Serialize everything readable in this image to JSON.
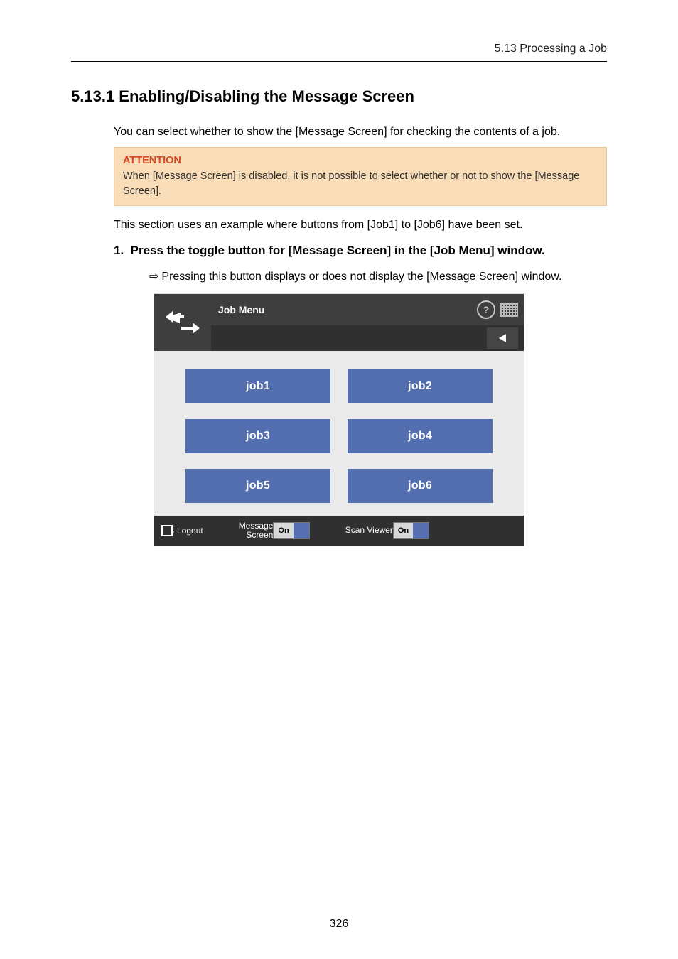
{
  "running_header": "5.13 Processing a Job",
  "section_title": "5.13.1 Enabling/Disabling the Message Screen",
  "intro_text": "You can select whether to show the [Message Screen] for checking the contents of a job.",
  "attention": {
    "title": "ATTENTION",
    "body": "When [Message Screen] is disabled, it is not possible to select whether or not to show the [Message Screen]."
  },
  "after_box_text": "This section uses an example where buttons from [Job1] to [Job6] have been set.",
  "step": {
    "number": "1.",
    "text": "Press the toggle button for [Message Screen] in the [Job Menu] window."
  },
  "result_line": "Pressing this button displays or does not display the [Message Screen] window.",
  "screenshot": {
    "title": "Job Menu",
    "help_icon_label": "?",
    "jobs": [
      "job1",
      "job2",
      "job3",
      "job4",
      "job5",
      "job6"
    ],
    "logout_label": "Logout",
    "message_screen": {
      "label_line1": "Message",
      "label_line2": "Screen",
      "state": "On"
    },
    "scan_viewer": {
      "label": "Scan Viewer",
      "state": "On"
    }
  },
  "page_number": "326"
}
